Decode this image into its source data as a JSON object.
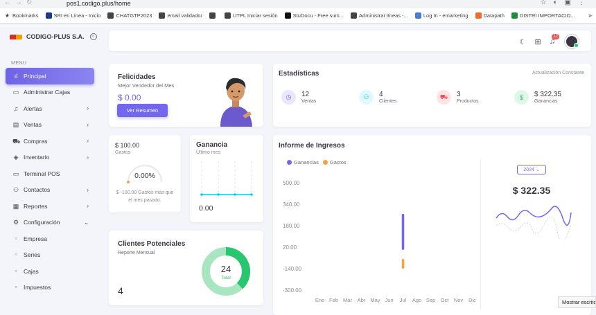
{
  "browser": {
    "url": "pos1.codigo.plus/home",
    "bookmarks": [
      {
        "label": "Bookmarks",
        "color": "#3c4043"
      },
      {
        "label": "SRI en Línea - Inicio",
        "color": "#1a3c8c"
      },
      {
        "label": "CHATGTP2023",
        "color": "#444"
      },
      {
        "label": "email validador",
        "color": "#444"
      },
      {
        "label": "",
        "color": "#444"
      },
      {
        "label": "UTPL Iniciar sesión",
        "color": "#444"
      },
      {
        "label": "StuDocu - Free sum...",
        "color": "#111"
      },
      {
        "label": "Administrar líneas -...",
        "color": "#444"
      },
      {
        "label": "Log In - emarketing",
        "color": "#4a7bd0"
      },
      {
        "label": "Datapath",
        "color": "#f26b2b"
      },
      {
        "label": "DISTRI IMPORTACIO...",
        "color": "#1e8e3e"
      }
    ]
  },
  "sidebar": {
    "brand": "CODIGO-PLUS S.A.",
    "menu_label": "MENU",
    "items": [
      {
        "label": "Principal",
        "icon": "chart-bars-icon",
        "glyph": "ıl",
        "chevron": false,
        "active": true,
        "sub": false
      },
      {
        "label": "Administrar Cajas",
        "icon": "cash-register-icon",
        "glyph": "▭",
        "chevron": false,
        "active": false,
        "sub": false
      },
      {
        "label": "Alertas",
        "icon": "bell-icon",
        "glyph": "♫",
        "chevron": true,
        "active": false,
        "sub": false
      },
      {
        "label": "Ventas",
        "icon": "document-icon",
        "glyph": "▤",
        "chevron": true,
        "active": false,
        "sub": false
      },
      {
        "label": "Compras",
        "icon": "cart-icon",
        "glyph": "⛟",
        "chevron": true,
        "active": false,
        "sub": false
      },
      {
        "label": "Inventario",
        "icon": "box-icon",
        "glyph": "◈",
        "chevron": true,
        "active": false,
        "sub": false
      },
      {
        "label": "Terminal POS",
        "icon": "terminal-icon",
        "glyph": "▭",
        "chevron": false,
        "active": false,
        "sub": false
      },
      {
        "label": "Contactos",
        "icon": "users-icon",
        "glyph": "⚇",
        "chevron": true,
        "active": false,
        "sub": false
      },
      {
        "label": "Reportes",
        "icon": "calendar-icon",
        "glyph": "▦",
        "chevron": true,
        "active": false,
        "sub": false
      },
      {
        "label": "Configuración",
        "icon": "gear-icon",
        "glyph": "⚙",
        "chevron": "down",
        "active": false,
        "sub": false
      },
      {
        "label": "Empresa",
        "icon": "circle-icon",
        "glyph": "○",
        "chevron": false,
        "active": false,
        "sub": true
      },
      {
        "label": "Series",
        "icon": "circle-icon",
        "glyph": "○",
        "chevron": false,
        "active": false,
        "sub": true
      },
      {
        "label": "Cajas",
        "icon": "circle-icon",
        "glyph": "○",
        "chevron": false,
        "active": false,
        "sub": true
      },
      {
        "label": "Impuestos",
        "icon": "circle-icon",
        "glyph": "○",
        "chevron": false,
        "active": false,
        "sub": true
      }
    ]
  },
  "topbar": {
    "notification_count": "12"
  },
  "felicidades": {
    "title": "Felicidades",
    "subtitle": "Mejor Vendedor del Mes",
    "amount": "$ 0.00",
    "button": "Ver Resumen"
  },
  "estadisticas": {
    "title": "Estadísticas",
    "update": "Actualización Constante",
    "items": [
      {
        "value": "12",
        "label": "Ventas",
        "icon": "pie-chart-icon",
        "glyph": "◷",
        "color": "#7367f0",
        "bg": "#e9e7fd"
      },
      {
        "value": "4",
        "label": "Clientes",
        "icon": "users-icon",
        "glyph": "⚇",
        "color": "#00cfe8",
        "bg": "#e0f9fc"
      },
      {
        "value": "3",
        "label": "Productos",
        "icon": "cart-icon",
        "glyph": "⛟",
        "color": "#ea5455",
        "bg": "#fce4e4"
      },
      {
        "value": "$ 322.35",
        "label": "Ganancias",
        "icon": "dollar-icon",
        "glyph": "$",
        "color": "#28c76f",
        "bg": "#dff7e9"
      }
    ]
  },
  "gastos": {
    "value": "$ 100.00",
    "label": "Gastos",
    "percent": "0.00%",
    "gauge_fraction": 0,
    "note": "$ -100.00 Gastos más que el mes pasado."
  },
  "ganancia": {
    "title": "Ganancia",
    "subtitle": "Último mes",
    "value": "0.00"
  },
  "clientes": {
    "title": "Clientes Potenciales",
    "subtitle": "Reporte Mensual",
    "value": "4",
    "donut_value": "24",
    "donut_label": "Total"
  },
  "informe": {
    "title": "Informe de Ingresos",
    "year": "2024",
    "total": "$ 322.35",
    "tooltip": "Mostrar escrito"
  },
  "colors": {
    "primary": "#7367f0",
    "warning": "#ff9f43",
    "success": "#28c76f",
    "info": "#00cfe8",
    "danger": "#ea5455"
  },
  "chart_data": {
    "type": "bar",
    "categories": [
      "Ene",
      "Feb",
      "Mar",
      "Abr",
      "May",
      "Jun",
      "Jul",
      "Ago",
      "Sep",
      "Oct",
      "Nov",
      "Dic"
    ],
    "series": [
      {
        "name": "Ganancias",
        "values": [
          0,
          0,
          0,
          0,
          0,
          0,
          322.35,
          0,
          0,
          0,
          0,
          0
        ]
      },
      {
        "name": "Gastos",
        "values": [
          0,
          0,
          0,
          0,
          0,
          0,
          -100,
          0,
          0,
          0,
          0,
          0
        ]
      }
    ],
    "yticks": [
      "500.00",
      "340.00",
      "180.00",
      "20.00",
      "-140.00",
      "-300.00"
    ],
    "ylim": [
      -300,
      500
    ],
    "legend": "top-left"
  }
}
